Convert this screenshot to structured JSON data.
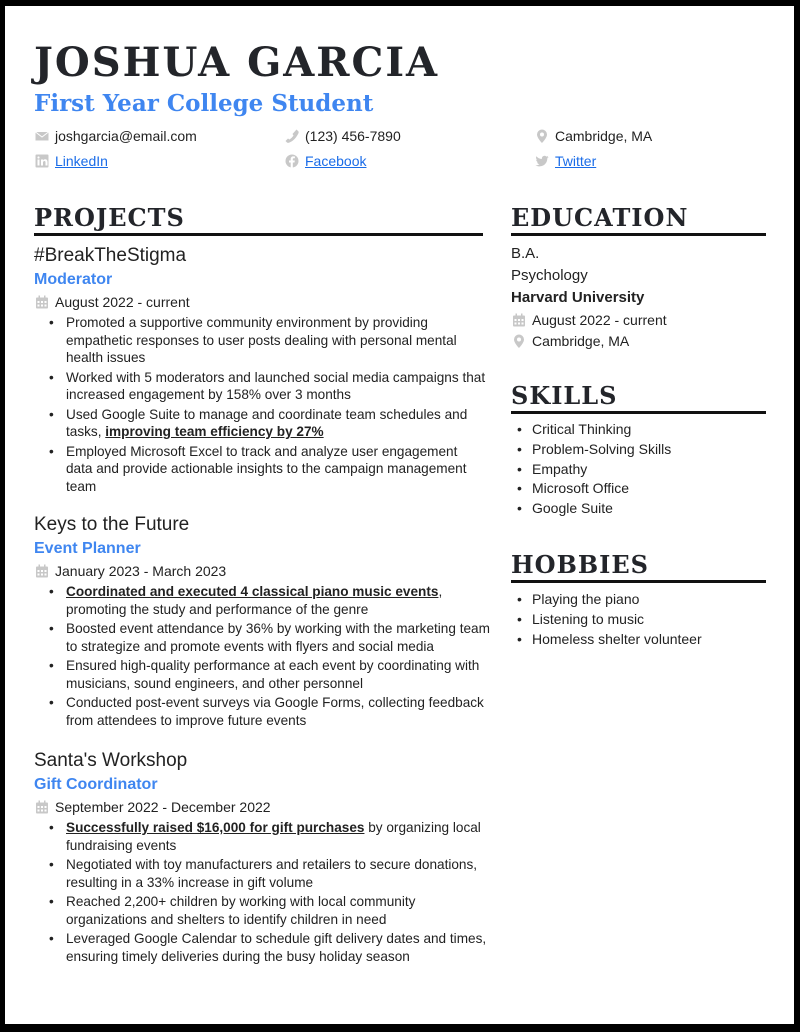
{
  "header": {
    "name": "JOSHUA GARCIA",
    "title": "First Year College Student"
  },
  "contact": {
    "email": {
      "icon": "envelope-icon",
      "text": "joshgarcia@email.com"
    },
    "phone": {
      "icon": "phone-icon",
      "text": "(123) 456-7890"
    },
    "location": {
      "icon": "map-pin-icon",
      "text": "Cambridge, MA"
    },
    "linkedin": {
      "icon": "linkedin-icon",
      "text": "LinkedIn"
    },
    "facebook": {
      "icon": "facebook-icon",
      "text": "Facebook"
    },
    "twitter": {
      "icon": "twitter-icon",
      "text": "Twitter"
    }
  },
  "projects": {
    "heading": "PROJECTS",
    "items": [
      {
        "name": "#BreakTheStigma",
        "role": "Moderator",
        "dates": "August 2022 - current",
        "bullets": [
          {
            "pre": "Promoted a supportive community environment by providing empathetic responses to user posts dealing with personal mental health issues",
            "bold": "",
            "post": ""
          },
          {
            "pre": "Worked with 5 moderators and launched social media campaigns that increased engagement by 158% over 3 months",
            "bold": "",
            "post": ""
          },
          {
            "pre": "Used Google Suite to manage and coordinate team schedules and tasks, ",
            "bold": "improving team efficiency by 27%",
            "post": ""
          },
          {
            "pre": "Employed Microsoft Excel to track and analyze user engagement data and provide actionable insights to the campaign management team",
            "bold": "",
            "post": ""
          }
        ]
      },
      {
        "name": "Keys to the Future",
        "role": "Event Planner",
        "dates": "January 2023 - March 2023",
        "bullets": [
          {
            "pre": "",
            "bold": "Coordinated and executed 4 classical piano music events",
            "post": ", promoting the study and performance of the genre"
          },
          {
            "pre": "Boosted event attendance by 36% by working with the marketing team to strategize and promote events with flyers and social media",
            "bold": "",
            "post": ""
          },
          {
            "pre": "Ensured high-quality performance at each event by coordinating with musicians, sound engineers, and other personnel",
            "bold": "",
            "post": ""
          },
          {
            "pre": "Conducted post-event surveys via Google Forms, collecting feedback from attendees to improve future events",
            "bold": "",
            "post": ""
          }
        ]
      },
      {
        "name": "Santa's Workshop",
        "role": "Gift Coordinator",
        "dates": "September 2022 - December 2022",
        "bullets": [
          {
            "pre": "",
            "bold": "Successfully raised $16,000 for gift purchases",
            "post": " by organizing local fundraising events"
          },
          {
            "pre": "Negotiated with toy manufacturers and retailers to secure donations, resulting in a 33% increase in gift volume",
            "bold": "",
            "post": ""
          },
          {
            "pre": "Reached 2,200+ children by working with local community organizations and shelters to identify children in need",
            "bold": "",
            "post": ""
          },
          {
            "pre": "Leveraged Google Calendar to schedule gift delivery dates and times, ensuring timely deliveries during the busy holiday season",
            "bold": "",
            "post": ""
          }
        ]
      }
    ]
  },
  "education": {
    "heading": "EDUCATION",
    "degree": "B.A.",
    "field": "Psychology",
    "school": "Harvard University",
    "dates": "August 2022 - current",
    "location": "Cambridge, MA"
  },
  "skills": {
    "heading": "SKILLS",
    "items": [
      "Critical Thinking",
      "Problem-Solving Skills",
      "Empathy",
      "Microsoft Office",
      "Google Suite"
    ]
  },
  "hobbies": {
    "heading": "HOBBIES",
    "items": [
      "Playing the piano",
      "Listening to music",
      "Homeless shelter volunteer"
    ]
  },
  "colors": {
    "accent": "#3f86f0",
    "link": "#1a6ce8",
    "icon": "#c8c8c8",
    "text": "#222222",
    "border": "#000000"
  }
}
